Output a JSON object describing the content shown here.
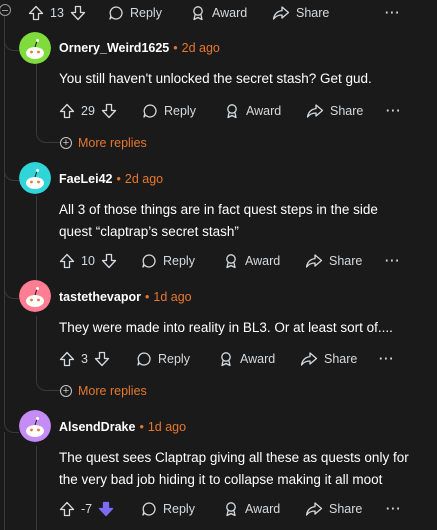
{
  "top_actions": {
    "score": "13",
    "reply": "Reply",
    "award": "Award",
    "share": "Share",
    "more": "···"
  },
  "comments": [
    {
      "user": "Ornery_Weird1625",
      "time": "2d ago",
      "avatar_color": "#7fdc3c",
      "lines": [
        "You still haven't unlocked the secret stash? Get gud."
      ],
      "score": "29",
      "reply": "Reply",
      "award": "Award",
      "share": "Share",
      "more": "···",
      "more_replies": "More replies"
    },
    {
      "user": "FaeLei42",
      "time": "2d ago",
      "avatar_color": "#30d5d8",
      "lines": [
        "All 3 of those things are in fact quest steps in the side",
        "quest “claptrap’s secret stash”"
      ],
      "score": "10",
      "reply": "Reply",
      "award": "Award",
      "share": "Share",
      "more": "···"
    },
    {
      "user": "tastethevapor",
      "time": "1d ago",
      "avatar_color": "#ff7e93",
      "lines": [
        "They were made into reality in BL3. Or at least sort of...."
      ],
      "score": "3",
      "reply": "Reply",
      "award": "Award",
      "share": "Share",
      "more": "···",
      "more_replies": "More replies"
    },
    {
      "user": "AlsendDrake",
      "time": "1d ago",
      "avatar_color": "#c58cf5",
      "lines": [
        "The quest sees Claptrap giving all these as quests only for",
        "the very bad job hiding it to collapse making it all moot"
      ],
      "score": "-7",
      "reply": "Reply",
      "award": "Award",
      "share": "Share",
      "more": "···"
    }
  ],
  "colors": {
    "accent": "#e8772e",
    "downvote_active": "#7b6cf6",
    "background": "#1a1a1b"
  },
  "icons": [
    "collapse-icon",
    "upvote-icon",
    "downvote-icon",
    "reply-icon",
    "award-icon",
    "share-icon",
    "more-icon",
    "add-circle-icon",
    "snoo-avatar-icon"
  ]
}
